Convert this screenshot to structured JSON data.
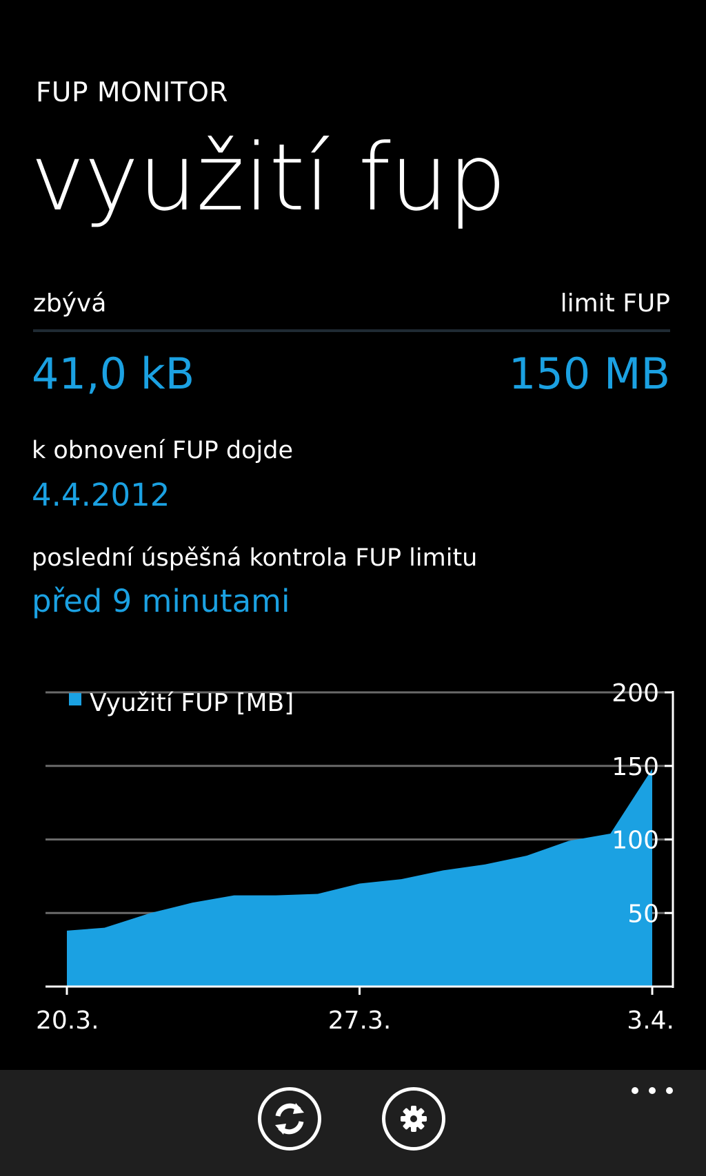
{
  "app": {
    "name": "FUP MONITOR",
    "page_title": "využití fup"
  },
  "summary": {
    "remaining_label": "zbývá",
    "limit_label": "limit FUP",
    "remaining_value": "41,0 kB",
    "limit_value": "150 MB",
    "renewal_label": "k obnovení FUP dojde",
    "renewal_date": "4.4.2012",
    "last_check_label": "poslední úspěšná kontrola FUP limitu",
    "last_check_value": "před 9 minutami"
  },
  "colors": {
    "accent": "#1ba1e2",
    "background": "#000000",
    "appbar": "#1f1f1f"
  },
  "chart_data": {
    "type": "area",
    "legend": "Využití FUP [MB]",
    "legend_position": "top-left",
    "y_axis_position": "right",
    "grid": true,
    "ylim": [
      0,
      200
    ],
    "y_ticks": [
      50,
      100,
      150,
      200
    ],
    "x_ticks": [
      {
        "day": 0,
        "label": "20.3."
      },
      {
        "day": 7,
        "label": "27.3."
      },
      {
        "day": 14,
        "label": "3.4."
      }
    ],
    "series": [
      {
        "name": "Využití FUP [MB]",
        "x": [
          0,
          0.9,
          2,
          3,
          4,
          5,
          6,
          7,
          8,
          9,
          10,
          11,
          12,
          13,
          14
        ],
        "values": [
          38,
          40,
          50,
          57,
          62,
          62,
          63,
          70,
          73,
          79,
          83,
          89,
          99,
          104,
          148
        ]
      }
    ]
  },
  "appbar": {
    "buttons": [
      {
        "icon": "refresh-icon"
      },
      {
        "icon": "gear-icon"
      }
    ],
    "more_icon": "ellipsis-icon"
  }
}
